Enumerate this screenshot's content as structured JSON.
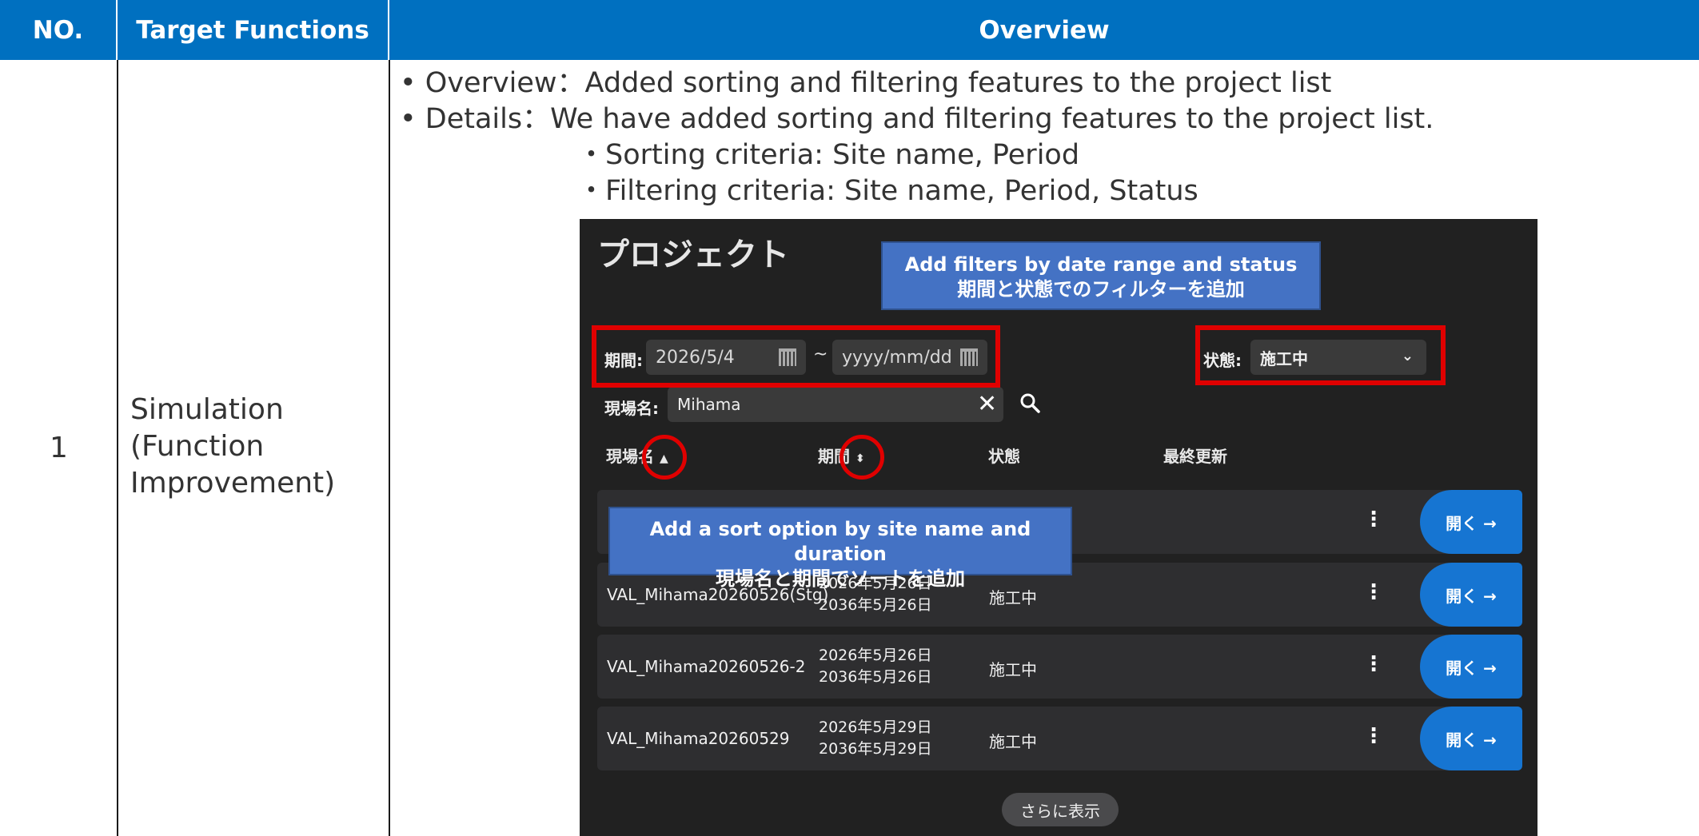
{
  "table": {
    "headers": {
      "no": "NO.",
      "target_functions": "Target Functions",
      "overview": "Overview"
    },
    "row": {
      "no": "1",
      "target_function": "Simulation (Function Improvement)",
      "bullets": [
        "• Overview：Added sorting and filtering features to the project list",
        "• Details：We have added sorting and filtering features to the project list."
      ],
      "sub_bullets": [
        "・Sorting criteria: Site name, Period",
        "・Filtering criteria: Site name, Period, Status"
      ]
    }
  },
  "screenshot": {
    "title": "プロジェクト",
    "callout_filter": {
      "line1": "Add filters by date range and status",
      "line2": "期間と状態でのフィルターを追加"
    },
    "callout_sort": {
      "line1": "Add a sort option by site name and duration",
      "line2": "現場名と期間でソートを追加"
    },
    "period_label": "期間:",
    "period_start": "2026/5/4",
    "period_sep": "~",
    "period_end_placeholder": "yyyy/mm/dd",
    "status_label": "状態:",
    "status_value": "施工中",
    "site_label": "現場名:",
    "site_value": "Mihama",
    "columns": {
      "site": "現場名",
      "period": "期間",
      "status": "状態",
      "updated": "最終更新"
    },
    "rows": [
      {
        "name": "",
        "start": "",
        "end": "",
        "status": "",
        "open": "開く →"
      },
      {
        "name": "VAL_Mihama20260526(Stg)",
        "start": "2026年5月26日",
        "end": "2036年5月26日",
        "status": "施工中",
        "open": "開く →"
      },
      {
        "name": "VAL_Mihama20260526-2",
        "start": "2026年5月26日",
        "end": "2036年5月26日",
        "status": "施工中",
        "open": "開く →"
      },
      {
        "name": "VAL_Mihama20260529",
        "start": "2026年5月29日",
        "end": "2036年5月29日",
        "status": "施工中",
        "open": "開く →"
      }
    ],
    "show_more": "さらに表示"
  },
  "colors": {
    "header_blue": "#0070c0",
    "callout_blue": "#4472c4",
    "highlight_red": "#e00000",
    "open_button": "#1675d2"
  }
}
